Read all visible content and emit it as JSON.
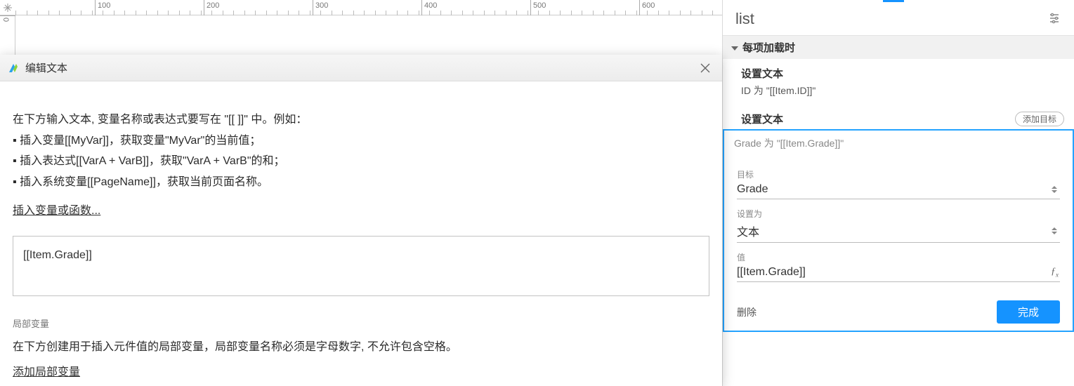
{
  "ruler": {
    "marks": [
      "100",
      "200",
      "300",
      "400",
      "500",
      "600"
    ],
    "vmark": "0"
  },
  "modal": {
    "title": "编辑文本",
    "intro": "在下方输入文本, 变量名称或表达式要写在 \"[[ ]]\" 中。例如：",
    "example1": "▪ 插入变量[[MyVar]]，获取变量\"MyVar\"的当前值；",
    "example2": "▪ 插入表达式[[VarA + VarB]]，获取\"VarA + VarB\"的和；",
    "example3": "▪ 插入系统变量[[PageName]]，获取当前页面名称。",
    "insert_link": "插入变量或函数...",
    "textbox_value": "[[Item.Grade]]",
    "local_var_heading": "局部变量",
    "local_var_hint": "在下方创建用于插入元件值的局部变量，局部变量名称必须是字母数字, 不允许包含空格。",
    "add_local_var": "添加局部变量"
  },
  "panel": {
    "widget_name": "list",
    "event_heading": "每项加载时",
    "action1_title": "设置文本",
    "action1_desc": "ID 为 \"[[Item.ID]]\"",
    "action2_title": "设置文本",
    "action2_add_target": "添加目标",
    "action2_desc": "Grade 为 \"[[Item.Grade]]\"",
    "target_label": "目标",
    "target_value": "Grade",
    "setto_label": "设置为",
    "setto_value": "文本",
    "value_label": "值",
    "value_value": "[[Item.Grade]]",
    "delete_label": "删除",
    "done_label": "完成"
  }
}
